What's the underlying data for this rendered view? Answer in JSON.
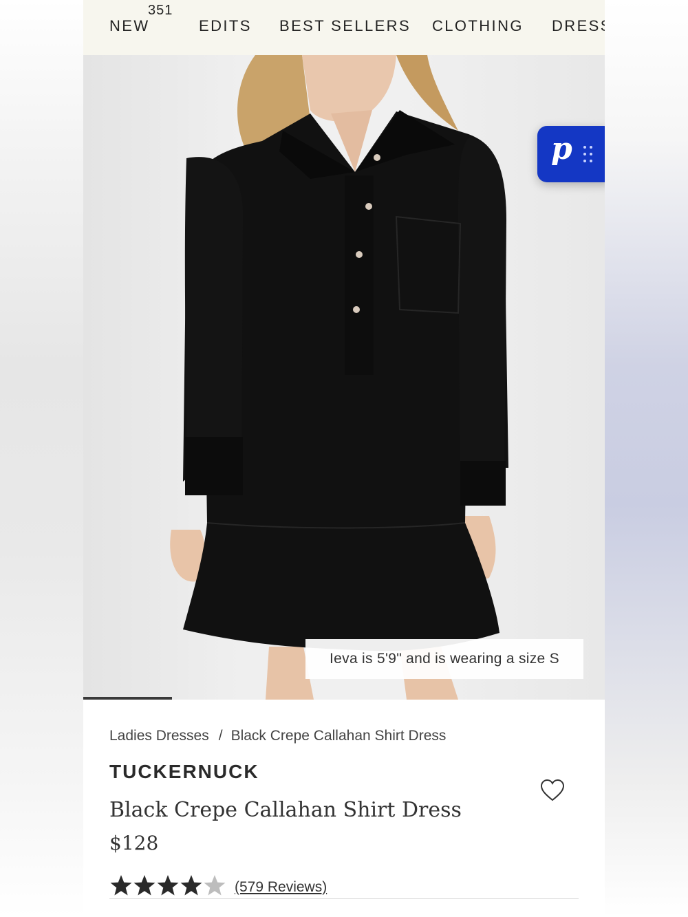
{
  "nav": {
    "items": [
      "NEW",
      "EDITS",
      "BEST SELLERS",
      "CLOTHING",
      "DRESS"
    ],
    "badge": "351"
  },
  "hero": {
    "caption": "Ieva is 5'9\" and is wearing a size S",
    "carousel_progress": 0.17
  },
  "assistant_button": {
    "letter": "p",
    "icon": "grip-dots-icon",
    "color": "#1437c4"
  },
  "breadcrumb": {
    "parent": "Ladies Dresses",
    "separator": "/",
    "current": "Black Crepe Callahan Shirt Dress"
  },
  "product": {
    "brand": "TUCKERNUCK",
    "title": "Black Crepe Callahan Shirt Dress",
    "price": "$128",
    "rating": 4,
    "rating_max": 5,
    "reviews_label": "(579 Reviews)",
    "wishlist_icon": "heart-icon"
  },
  "colors": {
    "nav_bg": "#f7f6ee",
    "dress": "#111111",
    "accent": "#1437c4"
  }
}
